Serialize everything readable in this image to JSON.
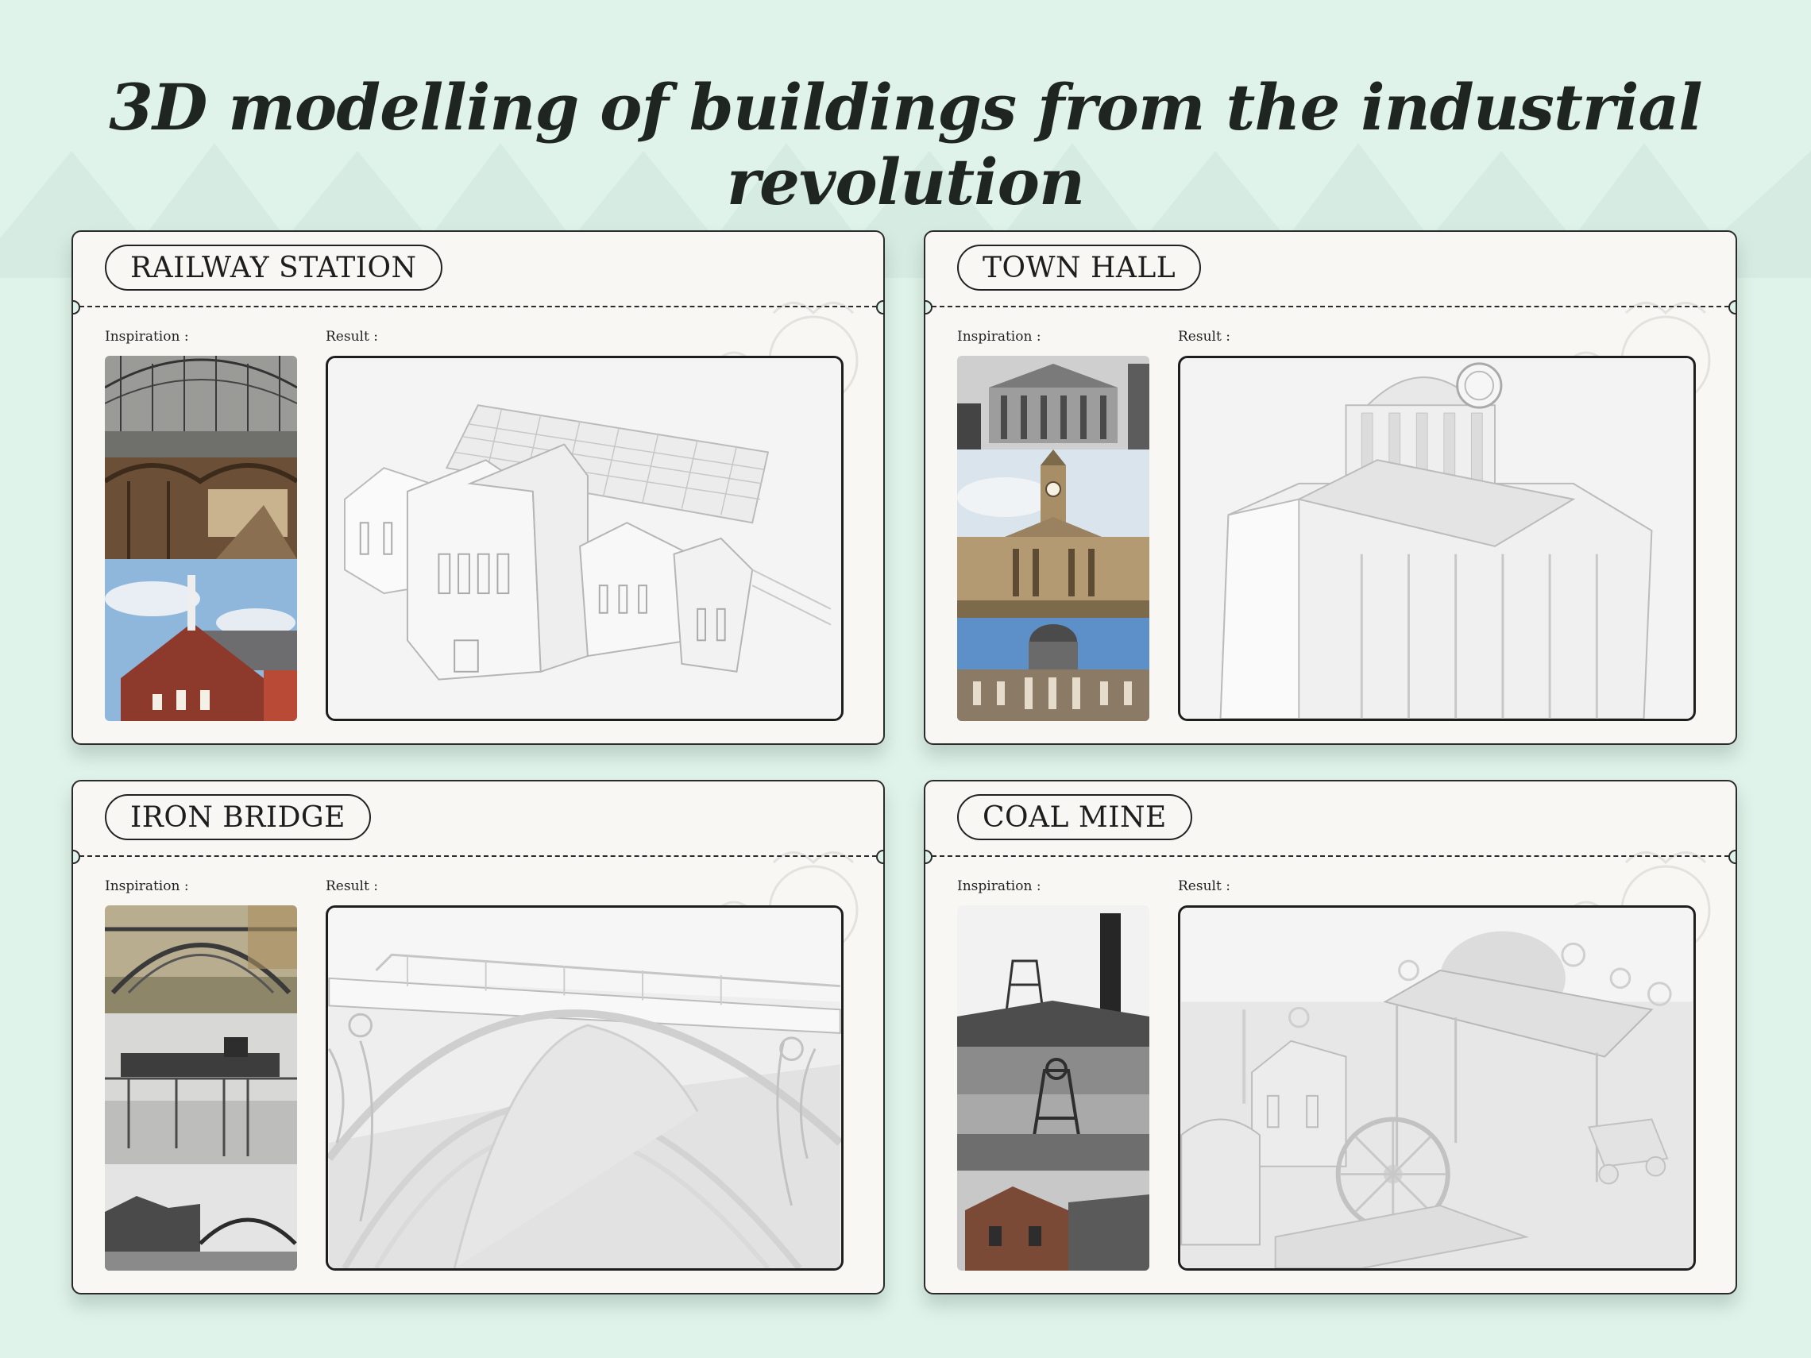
{
  "page": {
    "title": "3D modelling of buildings from the industrial revolution",
    "background_color": "#dff3ea"
  },
  "cards": [
    {
      "label": "RAILWAY STATION",
      "inspiration_label": "Inspiration :",
      "result_label": "Result :"
    },
    {
      "label": "TOWN HALL",
      "inspiration_label": "Inspiration :",
      "result_label": "Result :"
    },
    {
      "label": "IRON BRIDGE",
      "inspiration_label": "Inspiration :",
      "result_label": "Result :"
    },
    {
      "label": "COAL MINE",
      "inspiration_label": "Inspiration :",
      "result_label": "Result :"
    }
  ]
}
